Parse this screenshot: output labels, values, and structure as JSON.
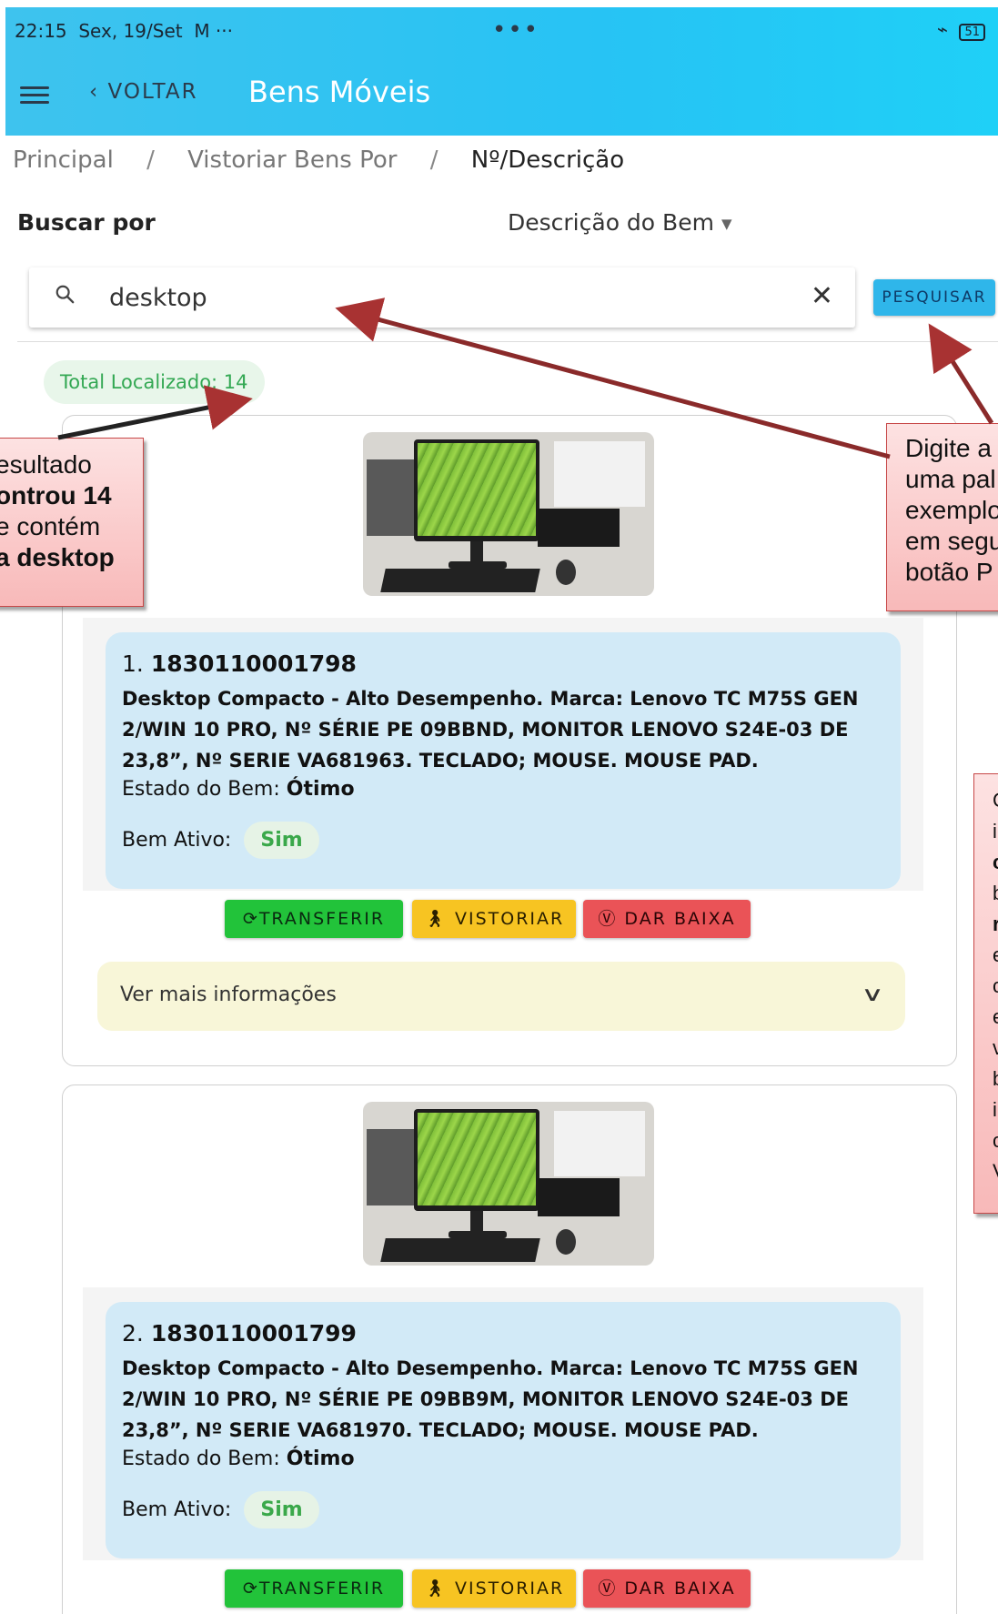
{
  "status": {
    "time": "22:15",
    "date": "Sex, 19/Set",
    "extra": "M ···",
    "center_dots": "•••",
    "battery": "51"
  },
  "appbar": {
    "back_label": "VOLTAR",
    "title": "Bens Móveis",
    "menu_icon": "hamburger-menu-icon",
    "back_icon": "chevron-left-icon"
  },
  "breadcrumb": {
    "items": [
      "Principal",
      "Vistoriar Bens Por",
      "Nº/Descrição"
    ],
    "separator": "/"
  },
  "search": {
    "label": "Buscar por",
    "mode": "Descrição do Bem",
    "value": "desktop",
    "button": "PESQUISAR"
  },
  "total": "Total Localizado: 14",
  "items": [
    {
      "index": "1.",
      "number": "1830110001798",
      "description": "Desktop Compacto - Alto Desempenho. Marca: Lenovo TC M75S GEN 2/WIN 10 PRO, Nº SÉRIE PE 09BBND, MONITOR LENOVO S24E-03 DE 23,8”, Nº SERIE VA681963. TECLADO; MOUSE. MOUSE PAD.",
      "state_label": "Estado do Bem:",
      "state_value": "Ótimo",
      "active_label": "Bem Ativo:",
      "active_value": "Sim",
      "more": "Ver mais informações"
    },
    {
      "index": "2.",
      "number": "1830110001799",
      "description": "Desktop Compacto - Alto Desempenho. Marca: Lenovo TC M75S GEN 2/WIN 10 PRO, Nº SÉRIE PE 09BB9M, MONITOR LENOVO S24E-03 DE 23,8”, Nº SERIE VA681970. TECLADO; MOUSE. MOUSE PAD.",
      "state_label": "Estado do Bem:",
      "state_value": "Ótimo",
      "active_label": "Bem Ativo:",
      "active_value": "Sim"
    }
  ],
  "actions": {
    "transfer": "TRANSFERIR",
    "inspect": "VISTORIAR",
    "write_off": "DAR BAIXA"
  },
  "annotations": {
    "left": [
      "esultado",
      "ontrou 14",
      "e contém",
      "a desktop"
    ],
    "right_top": [
      "Digite a",
      "uma pal",
      "exemplo",
      "em segu",
      "botão P"
    ],
    "right_mid": [
      "C",
      "i",
      "c",
      "b",
      "r",
      "e",
      "c",
      "e",
      "v",
      "b",
      "i",
      "c",
      "V"
    ]
  },
  "colors": {
    "appbar": "#27c3f4",
    "info_box": "#d2eaf7",
    "transfer": "#22c33a",
    "inspect": "#f7c422",
    "write_off": "#ea5357",
    "annotation_arrow": "#a83232"
  }
}
